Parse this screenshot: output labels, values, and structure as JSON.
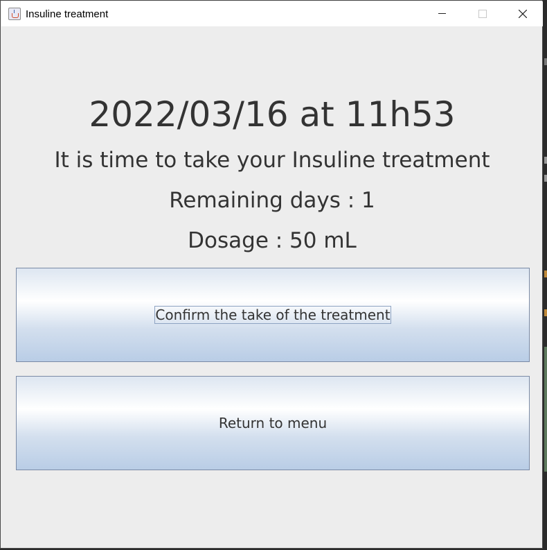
{
  "window": {
    "title": "Insuline treatment"
  },
  "reminder": {
    "datetime": "2022/03/16 at 11h53",
    "message": "It is time to take your Insuline treatment",
    "remaining_days": "Remaining days : 1",
    "dosage": "Dosage : 50 mL"
  },
  "buttons": {
    "confirm_label": "Confirm the take of the treatment",
    "return_label": "Return to menu"
  }
}
